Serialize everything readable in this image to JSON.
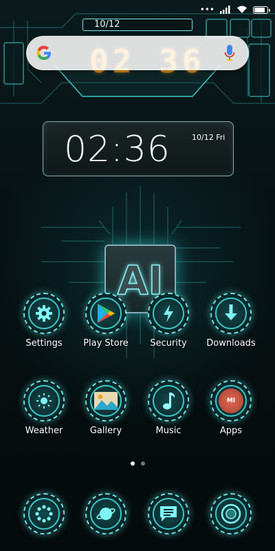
{
  "status_bar": {
    "signal_icon": "signal-bars-icon",
    "wifi_icon": "wifi-icon",
    "battery_icon": "battery-icon",
    "battery_level": 0.85
  },
  "hud": {
    "date": "10/12",
    "digits": "02 36"
  },
  "search_bar": {
    "google_icon": "google-g-icon",
    "mic_icon": "microphone-icon"
  },
  "clock_widget": {
    "time": "02:36",
    "date": "10/12 Fri"
  },
  "center_graphic": {
    "chip_text": "AI"
  },
  "apps_row1": [
    {
      "label": "Settings",
      "icon": "gear-icon"
    },
    {
      "label": "Play Store",
      "icon": "play-store-icon"
    },
    {
      "label": "Security",
      "icon": "lightning-icon"
    },
    {
      "label": "Downloads",
      "icon": "download-arrow-icon"
    }
  ],
  "apps_row2": [
    {
      "label": "Weather",
      "icon": "sun-icon"
    },
    {
      "label": "Gallery",
      "icon": "landscape-icon"
    },
    {
      "label": "Music",
      "icon": "music-note-icon"
    },
    {
      "label": "Apps",
      "icon": "mi-logo-icon",
      "logo_text": "MI"
    }
  ],
  "dock": [
    {
      "icon": "dial-dots-icon"
    },
    {
      "icon": "planet-icon"
    },
    {
      "icon": "message-icon"
    },
    {
      "icon": "camera-lens-icon"
    }
  ],
  "page_indicator": {
    "pages": 2,
    "active": 0
  },
  "colors": {
    "accent": "#6fdede",
    "digits": "#f39a1e",
    "background": "#050a0b"
  }
}
